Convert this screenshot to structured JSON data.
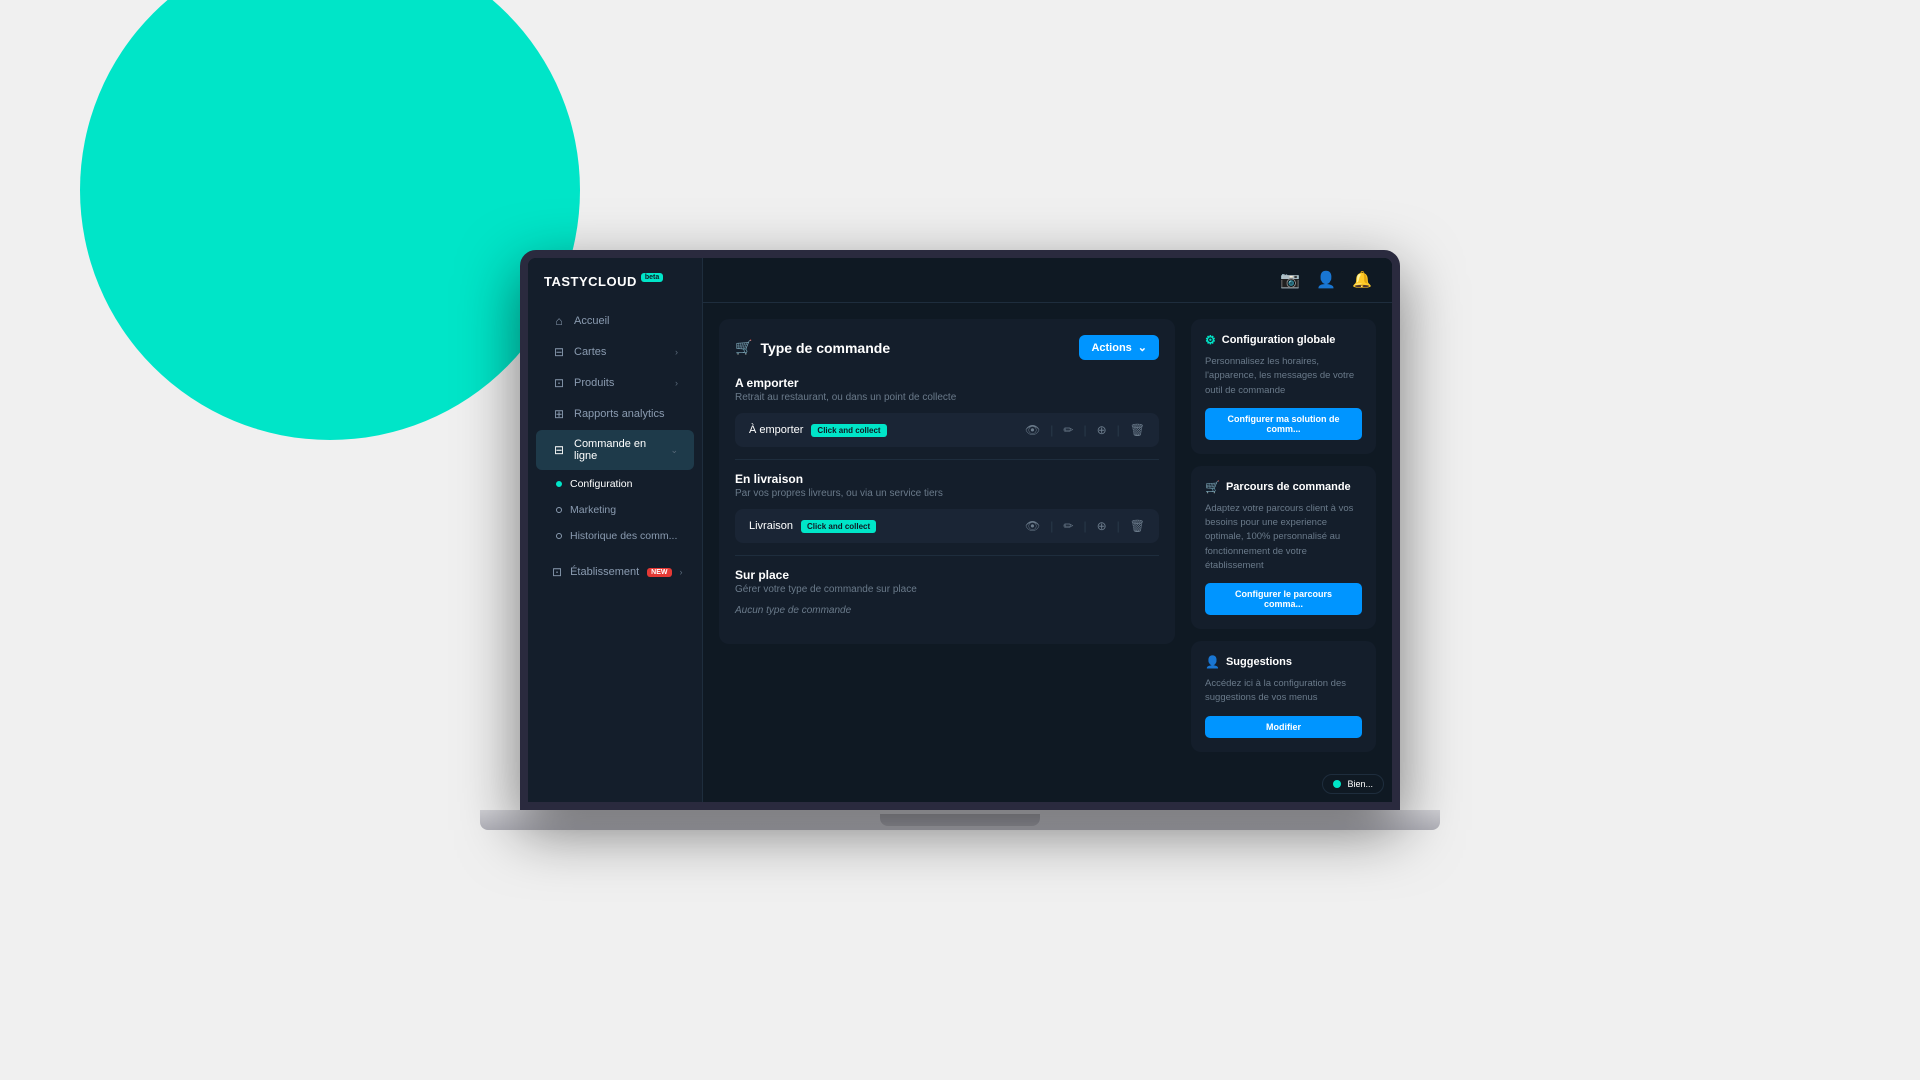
{
  "app": {
    "logo": "TASTYCLOUD",
    "logo_badge": "beta",
    "logo_icon": "⚡"
  },
  "sidebar": {
    "nav_items": [
      {
        "id": "accueil",
        "label": "Accueil",
        "icon": "🏠",
        "has_chevron": false
      },
      {
        "id": "cartes",
        "label": "Cartes",
        "icon": "📖",
        "has_chevron": true
      },
      {
        "id": "produits",
        "label": "Produits",
        "icon": "🎁",
        "has_chevron": true
      },
      {
        "id": "rapports",
        "label": "Rapports analytics",
        "icon": "📊",
        "has_chevron": false
      },
      {
        "id": "commande",
        "label": "Commande en ligne",
        "icon": "🛒",
        "has_chevron": true,
        "active": true
      }
    ],
    "sub_items": [
      {
        "id": "configuration",
        "label": "Configuration",
        "active": true
      },
      {
        "id": "marketing",
        "label": "Marketing",
        "active": false
      },
      {
        "id": "historique",
        "label": "Historique des comm...",
        "active": false
      }
    ],
    "bottom_item": {
      "id": "etablissement",
      "label": "Établissement",
      "icon": "👤",
      "has_chevron": true,
      "badge": "NEW"
    }
  },
  "topbar": {
    "icons": [
      "camera",
      "user",
      "bell"
    ]
  },
  "main": {
    "card_title": "Type de commande",
    "card_icon": "🛒",
    "actions_label": "Actions",
    "sections": [
      {
        "id": "a_emporter",
        "title": "A emporter",
        "subtitle": "Retrait au restaurant, ou dans un point de collecte",
        "types": [
          {
            "name": "À emporter",
            "tag": "Click and collect"
          }
        ]
      },
      {
        "id": "en_livraison",
        "title": "En livraison",
        "subtitle": "Par vos propres livreurs, ou via un service tiers",
        "types": [
          {
            "name": "Livraison",
            "tag": "Click and collect"
          }
        ]
      },
      {
        "id": "sur_place",
        "title": "Sur place",
        "subtitle": "Gérer votre type de commande sur place",
        "types": [],
        "empty_text": "Aucun type de commande"
      }
    ]
  },
  "right_sidebar": {
    "widgets": [
      {
        "id": "config_globale",
        "icon": "⚙️",
        "title": "Configuration globale",
        "text": "Personnalisez les horaires, l'apparence, les messages de votre outil de commande",
        "btn_label": "Configurer ma solution de comm..."
      },
      {
        "id": "parcours_commande",
        "icon": "🛒",
        "title": "Parcours de commande",
        "text": "Adaptez votre parcours client à vos besoins pour une experience optimale, 100% personnalisé au fonctionnement de votre établissement",
        "btn_label": "Configurer le parcours comma..."
      },
      {
        "id": "suggestions",
        "icon": "👤",
        "title": "Suggestions",
        "text": "Accédez ici à la configuration des suggestions de vos menus",
        "btn_label": "Modifier"
      }
    ]
  },
  "chat_bubble": {
    "text": "Bien..."
  },
  "colors": {
    "accent": "#00e5c8",
    "blue": "#0095ff",
    "dark_bg": "#0f1923",
    "sidebar_bg": "#141e2b",
    "card_bg": "#141e2b",
    "row_bg": "#1a2535"
  }
}
